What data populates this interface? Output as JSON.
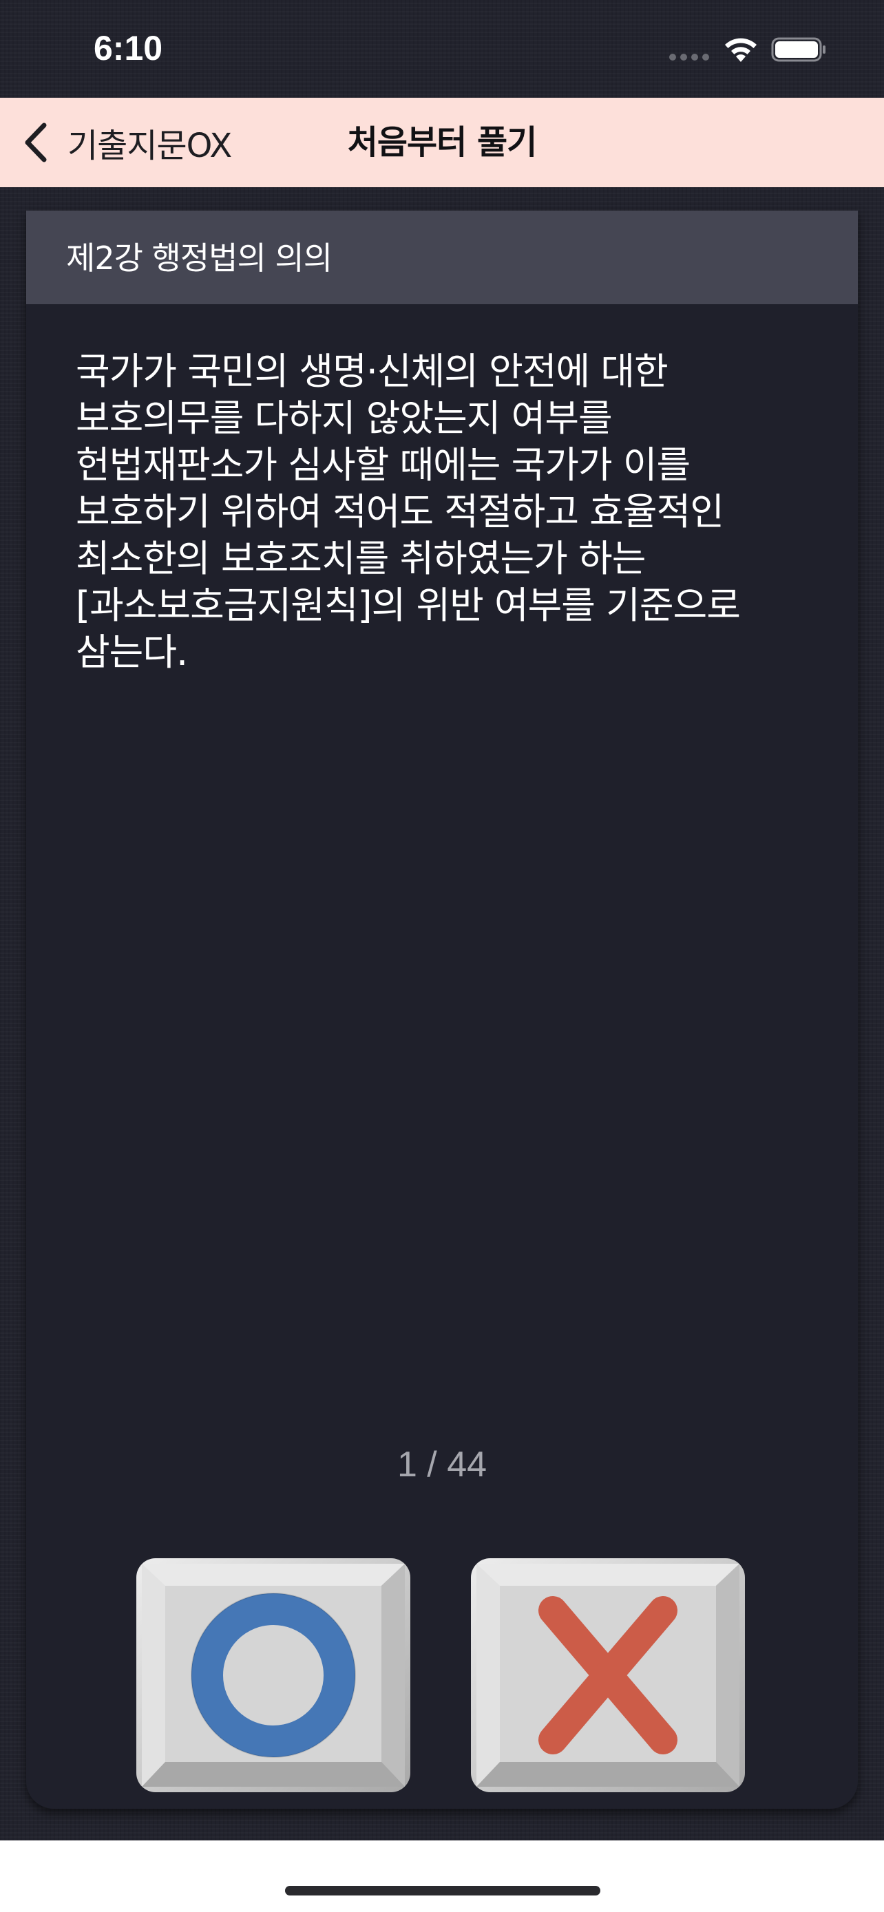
{
  "status_bar": {
    "time": "6:10",
    "icons": [
      "cellular-signal-icon",
      "wifi-icon",
      "battery-icon"
    ]
  },
  "nav": {
    "back_label": "기출지문OX",
    "title": "처음부터 풀기"
  },
  "card": {
    "chapter_title": "제2강 행정법의 의의",
    "question": "국가가 국민의 생명·신체의 안전에 대한 보호의무를 다하지 않았는지 여부를 헌법재판소가 심사할 때에는 국가가 이를 보호하기 위하여 적어도 적절하고 효율적인 최소한의 보호조치를 취하였는가 하는 [과소보호금지원칙]의 위반 여부를 기준으로 삼는다.",
    "page_indicator": "1 / 44"
  },
  "answers": {
    "o_icon": "circle-o-icon",
    "x_icon": "cross-x-icon"
  },
  "colors": {
    "background": "#22232d",
    "nav_background": "#fde0da",
    "card_header": "#454653",
    "card_body": "#1f202b",
    "o_blue": "#4577b6",
    "x_red": "#cc5c48",
    "key_face": "#d6d6d6"
  }
}
